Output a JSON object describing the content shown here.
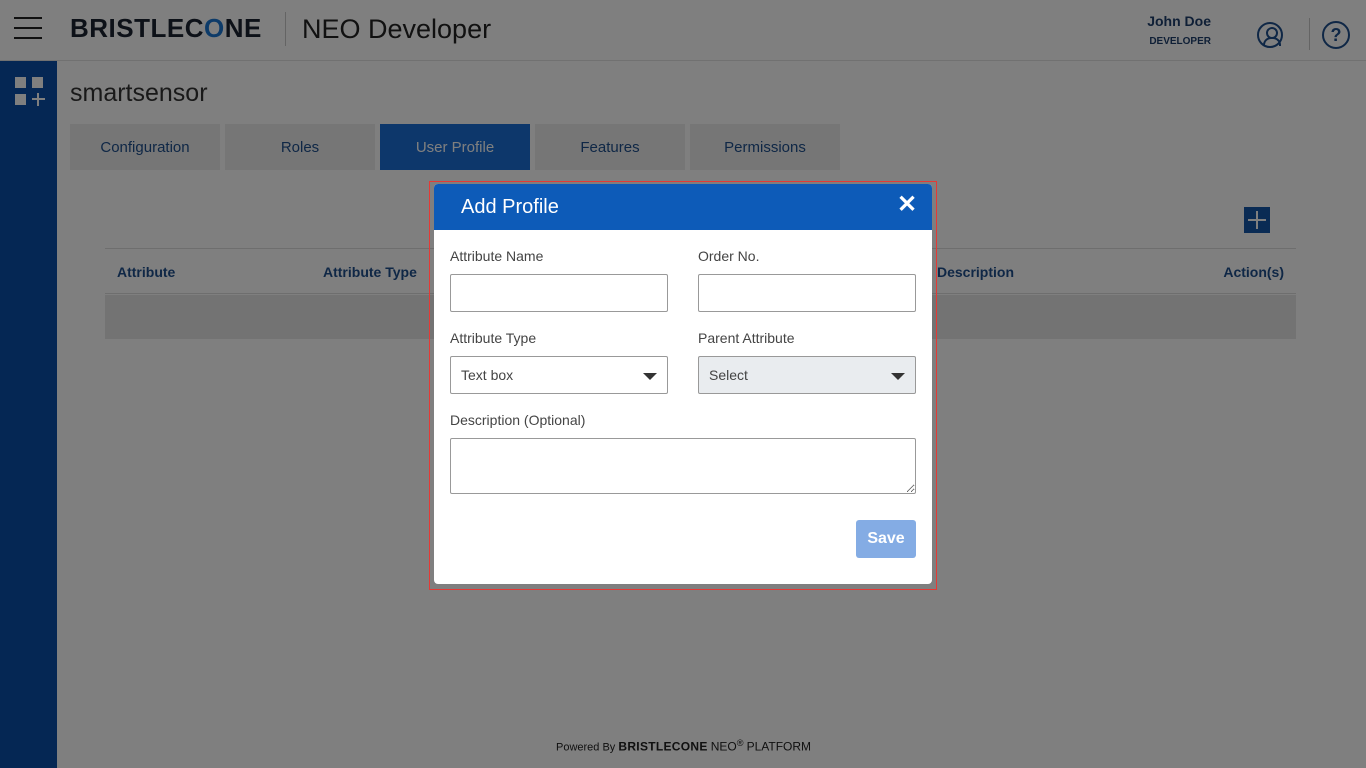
{
  "header": {
    "logo_pre": "BRISTLEC",
    "logo_o": "O",
    "logo_post": "NE",
    "app_name": "NEO Developer",
    "user_name": "John Doe",
    "user_role": "DEVELOPER",
    "help_glyph": "?"
  },
  "page": {
    "title": "smartsensor"
  },
  "tabs": [
    {
      "label": "Configuration",
      "active": false
    },
    {
      "label": "Roles",
      "active": false
    },
    {
      "label": "User Profile",
      "active": true
    },
    {
      "label": "Features",
      "active": false
    },
    {
      "label": "Permissions",
      "active": false
    }
  ],
  "table": {
    "columns": [
      "Attribute",
      "Attribute Type",
      "Description",
      "Action(s)"
    ]
  },
  "footer": {
    "powered_by": "Powered By",
    "brand": "BRISTLECONE",
    "neo": "NEO",
    "reg": "®",
    "platform": "PLATFORM"
  },
  "modal": {
    "title": "Add Profile",
    "close_glyph": "✕",
    "attribute_name_label": "Attribute Name",
    "attribute_name_value": "",
    "order_no_label": "Order No.",
    "order_no_value": "",
    "attribute_type_label": "Attribute Type",
    "attribute_type_value": "Text box",
    "parent_attribute_label": "Parent Attribute",
    "parent_attribute_value": "Select",
    "description_label": "Description (Optional)",
    "description_value": "",
    "save_label": "Save"
  },
  "colors": {
    "sidebar": "#0b4fa8",
    "modal_header": "#0d5bb8",
    "active_tab": "#1a6fd6",
    "save_button": "#6f9ee0",
    "outline": "#e53935"
  }
}
